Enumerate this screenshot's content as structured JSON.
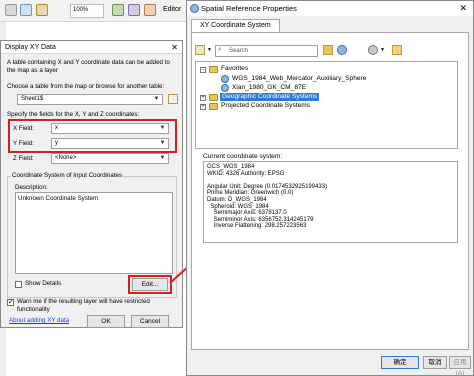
{
  "background_app": {
    "zoom": "100%",
    "editor_label": "Editor"
  },
  "display_xy": {
    "title": "Display XY Data",
    "intro_text": "A table containing X and Y coordinate data can be added to the map as a layer",
    "choose_label": "Choose a table from the map or browse for another table:",
    "table_value": "Sheet1$",
    "fields_label": "Specify the fields for the X, Y and Z coordinates:",
    "x_label": "X Field:",
    "x_value": "x",
    "y_label": "Y Field:",
    "y_value": "y",
    "z_label": "Z Field:",
    "z_value": "<None>",
    "coord_group_label": "Coordinate System of Input Coordinates",
    "description_label": "Description:",
    "description_value": "Unknown Coordinate System",
    "show_details_label": "Show Details",
    "edit_button": "Edit...",
    "warn_label": "Warn me if the resulting layer will have restricted functionality",
    "about_link": "About adding XY data",
    "ok_button": "OK",
    "cancel_button": "Cancel"
  },
  "spatial_ref": {
    "title": "Spatial Reference Properties",
    "tab_label": "XY Coordinate System",
    "search_placeholder": "Search",
    "tree": {
      "favorites": "Favorites",
      "fav_item1": "WGS_1984_Web_Mercator_Auxiliary_Sphere",
      "fav_item2": "Xian_1980_GK_CM_87E",
      "geographic": "Geographic Coordinate Systems",
      "projected": "Projected Coordinate Systems"
    },
    "current_label": "Current coordinate system:",
    "current_lines": [
      "GCS_WGS_1984",
      "WKID: 4326 Authority: EPSG",
      "",
      "Angular Unit: Degree (0.0174532925199433)",
      "Prime Meridian: Greenwich (0.0)",
      "Datum: D_WGS_1984",
      "  Spheroid: WGS_1984",
      "    Semimajor Axis: 6378137.0",
      "    Semiminor Axis: 6356752.314245179",
      "    Inverse Flattening: 298.257223563"
    ],
    "ok_button": "确定",
    "cancel_button": "取消",
    "apply_button": "应用(A)"
  },
  "colors": {
    "highlight_red": "#d42020",
    "selection_blue": "#3178d6"
  }
}
